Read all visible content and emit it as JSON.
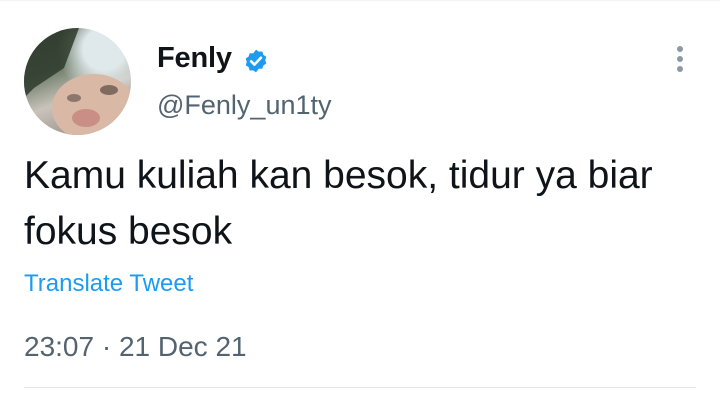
{
  "author": {
    "display_name": "Fenly",
    "handle": "@Fenly_un1ty",
    "verified": true
  },
  "tweet": {
    "text": "Kamu kuliah kan besok, tidur ya biar fokus besok",
    "translate_label": "Translate Tweet",
    "time": "23:07",
    "separator": "·",
    "date": "21 Dec 21"
  },
  "icons": {
    "verified": "verified-badge-icon",
    "more": "more-options-icon"
  },
  "colors": {
    "text": "#0f1419",
    "secondary": "#536471",
    "link": "#1d9bf0",
    "verified": "#1d9bf0"
  }
}
